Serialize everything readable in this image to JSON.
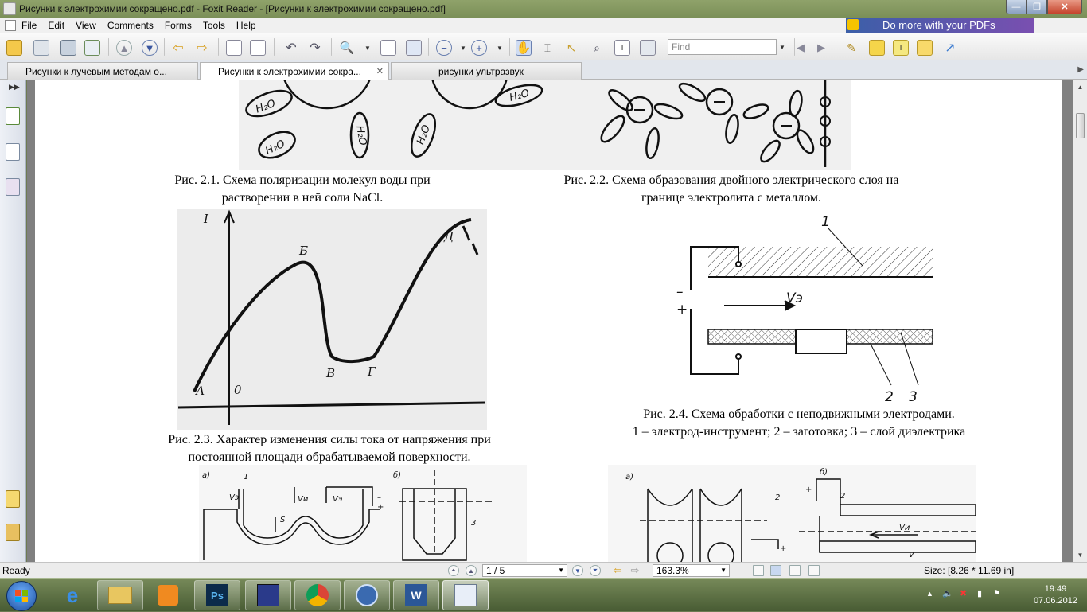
{
  "window": {
    "title": "Рисунки к электрохимии сокращено.pdf - Foxit Reader - [Рисунки к электрохимии сокращено.pdf]",
    "minimize_label": "—",
    "maximize_label": "❐",
    "close_label": "✕"
  },
  "menu": {
    "items": [
      "File",
      "Edit",
      "View",
      "Comments",
      "Forms",
      "Tools",
      "Help"
    ]
  },
  "promo": {
    "text": "Do more with your PDFs"
  },
  "toolbar": {
    "find_placeholder": "Find"
  },
  "tabs": [
    {
      "label": "Рисунки к лучевым методам о..."
    },
    {
      "label": "Рисунки к электрохимии сокра...",
      "active": true
    },
    {
      "label": "рисунки ультразвук"
    }
  ],
  "document": {
    "captions": {
      "fig21": [
        "Рис. 2.1. Схема поляризации молекул воды при",
        "растворении в ней соли NaCl."
      ],
      "fig22": [
        "Рис. 2.2. Схема образования двойного электрического слоя на",
        "границе электролита с металлом."
      ],
      "fig23": [
        "Рис. 2.3. Характер изменения силы тока от напряжения при",
        "постоянной площади обрабатываемой поверхности."
      ],
      "fig24": [
        "Рис. 2.4. Схема обработки с неподвижными электродами.",
        "1 – электрод-инструмент; 2 – заготовка; 3 – слой диэлектрика"
      ]
    },
    "fig21_labels": [
      "H₂O",
      "H₂O",
      "H₂O",
      "H₂O",
      "H₂O"
    ],
    "fig23_labels": {
      "y_axis": "I",
      "origin": "0",
      "A": "А",
      "B": "Б",
      "V": "В",
      "G": "Г",
      "D": "Д"
    },
    "fig24_labels": {
      "one": "1",
      "two": "2",
      "three": "3",
      "minus": "–",
      "plus": "+",
      "velocity": "Vэ"
    },
    "fig25_labels": {
      "a": "а)",
      "b": "б)",
      "one": "1",
      "s": "S",
      "vi": "Vи",
      "ve": "Vэ",
      "ve2": "Vэ",
      "minus": "–",
      "plus": "+",
      "three": "3"
    },
    "fig26_labels": {
      "a": "а)",
      "b": "б)",
      "two": "2",
      "plus": "+",
      "minus": "–",
      "vi": "Vи",
      "v": "V"
    }
  },
  "status": {
    "ready": "Ready",
    "page": "1 / 5",
    "zoom": "163.3%",
    "size": "Size: [8.26 * 11.69 in]"
  },
  "taskbar": {
    "time": "19:49",
    "date": "07.06.2012"
  },
  "colors": {
    "accent": "#3b5fa8",
    "title_bar": "#7b8f58",
    "start_button": "#1c4f9e"
  }
}
